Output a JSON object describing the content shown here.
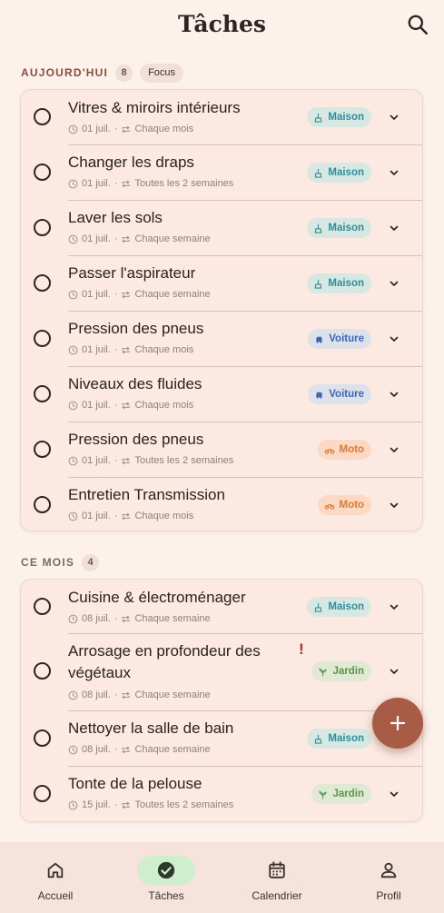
{
  "header": {
    "title": "Tâches",
    "search_icon": "search-icon"
  },
  "sections": [
    {
      "title": "AUJOURD'HUI",
      "title_color": "#8a4f3e",
      "count": "8",
      "chip": "Focus",
      "tasks": [
        {
          "title": "Vitres & miroirs intérieurs",
          "date": "01 juil.",
          "recurrence": "Chaque mois",
          "tag": "Maison",
          "tag_type": "maison"
        },
        {
          "title": "Changer les draps",
          "date": "01 juil.",
          "recurrence": "Toutes les 2 semaines",
          "tag": "Maison",
          "tag_type": "maison"
        },
        {
          "title": "Laver les sols",
          "date": "01 juil.",
          "recurrence": "Chaque semaine",
          "tag": "Maison",
          "tag_type": "maison"
        },
        {
          "title": "Passer l'aspirateur",
          "date": "01 juil.",
          "recurrence": "Chaque semaine",
          "tag": "Maison",
          "tag_type": "maison"
        },
        {
          "title": "Pression des pneus",
          "date": "01 juil.",
          "recurrence": "Chaque mois",
          "tag": "Voiture",
          "tag_type": "voiture"
        },
        {
          "title": "Niveaux des fluides",
          "date": "01 juil.",
          "recurrence": "Chaque mois",
          "tag": "Voiture",
          "tag_type": "voiture"
        },
        {
          "title": "Pression des pneus",
          "date": "01 juil.",
          "recurrence": "Toutes les 2 semaines",
          "tag": "Moto",
          "tag_type": "moto"
        },
        {
          "title": "Entretien Transmission",
          "date": "01 juil.",
          "recurrence": "Chaque mois",
          "tag": "Moto",
          "tag_type": "moto"
        }
      ]
    },
    {
      "title": "CE MOIS",
      "title_color": "#7a6a65",
      "count": "4",
      "tasks": [
        {
          "title": "Cuisine & électroménager",
          "date": "08 juil.",
          "recurrence": "Chaque semaine",
          "tag": "Maison",
          "tag_type": "maison"
        },
        {
          "title_line1": "Arrosage en profondeur des",
          "title_line2": "végétaux",
          "date": "08 juil.",
          "recurrence": "Chaque semaine",
          "tag": "Jardin",
          "tag_type": "jardin",
          "alert": "!"
        },
        {
          "title": "Nettoyer la salle de bain",
          "date": "08 juil.",
          "recurrence": "Chaque semaine",
          "tag": "Maison",
          "tag_type": "maison"
        },
        {
          "title": "Tonte de la pelouse",
          "date": "15 juil.",
          "recurrence": "Toutes les 2 semaines",
          "tag": "Jardin",
          "tag_type": "jardin"
        }
      ]
    }
  ],
  "meta_separator": "·",
  "fab": {
    "icon": "plus-icon"
  },
  "bottom_nav": [
    {
      "label": "Accueil",
      "icon": "home-icon"
    },
    {
      "label": "Tâches",
      "icon": "check-circle-icon",
      "active": true
    },
    {
      "label": "Calendrier",
      "icon": "calendar-icon"
    },
    {
      "label": "Profil",
      "icon": "user-icon"
    }
  ],
  "colors": {
    "background": "#fdf1ec",
    "card": "#fce9e1",
    "fab": "#a95c45",
    "nav_active": "#cfeecd",
    "alert": "#c62828"
  }
}
